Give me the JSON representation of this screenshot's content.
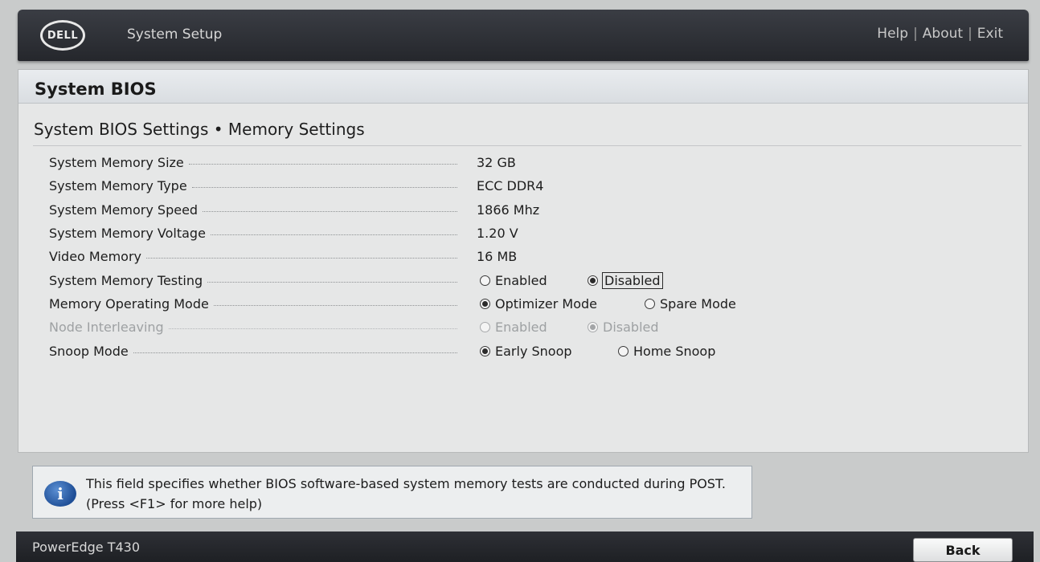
{
  "header": {
    "logo_text": "DELL",
    "app_title": "System Setup",
    "links": [
      "Help",
      "About",
      "Exit"
    ],
    "separator": "|"
  },
  "panel": {
    "title": "System BIOS",
    "subtitle": "System BIOS Settings • Memory Settings"
  },
  "settings": {
    "memory_size": {
      "label": "System Memory Size",
      "value": "32 GB"
    },
    "memory_type": {
      "label": "System Memory Type",
      "value": "ECC DDR4"
    },
    "memory_speed": {
      "label": "System Memory Speed",
      "value": "1866 Mhz"
    },
    "memory_voltage": {
      "label": "System Memory Voltage",
      "value": "1.20 V"
    },
    "video_memory": {
      "label": "Video Memory",
      "value": "16 MB"
    },
    "memory_testing": {
      "label": "System Memory Testing",
      "options": [
        "Enabled",
        "Disabled"
      ],
      "selected": "Disabled"
    },
    "operating_mode": {
      "label": "Memory Operating Mode",
      "options": [
        "Optimizer Mode",
        "Spare Mode"
      ],
      "selected": "Optimizer Mode"
    },
    "node_interleaving": {
      "label": "Node Interleaving",
      "options": [
        "Enabled",
        "Disabled"
      ],
      "selected": "Disabled",
      "disabled": true
    },
    "snoop_mode": {
      "label": "Snoop Mode",
      "options": [
        "Early Snoop",
        "Home Snoop"
      ],
      "selected": "Early Snoop"
    }
  },
  "help": {
    "text": "This field specifies whether BIOS software-based system memory tests are conducted during POST. (Press <F1> for more help)"
  },
  "footer": {
    "model": "PowerEdge T430",
    "back_label": "Back"
  }
}
